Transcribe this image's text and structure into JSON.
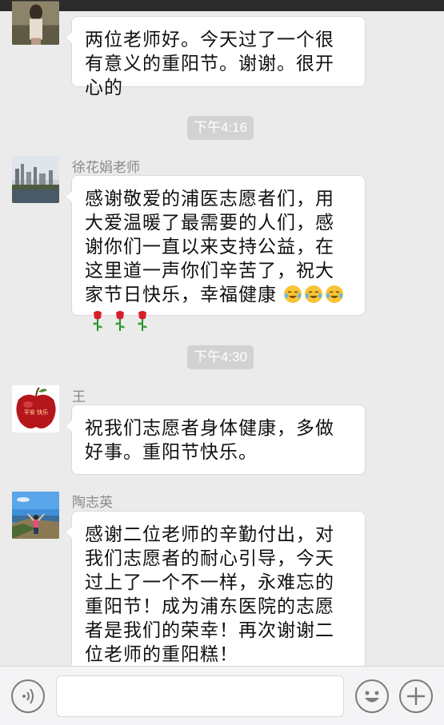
{
  "messages": [
    {
      "sender": "",
      "text": "两位老师好。今天过了一个很有意义的重阳节。谢谢。很开心的",
      "avatar_icon": "person-photo-avatar"
    },
    {
      "sender": "徐花娟老师",
      "text": "感谢敬爱的浦医志愿者们，用大爱温暖了最需要的人们，感谢你们一直以来支持公益，在这里道一声你们辛苦了，祝大家节日快乐，幸福健康",
      "emoji": [
        "laughing-tears-emoji",
        "laughing-tears-emoji",
        "laughing-tears-emoji",
        "rose-emoji",
        "rose-emoji",
        "rose-emoji"
      ],
      "avatar_icon": "city-skyline-avatar"
    },
    {
      "sender": "王",
      "text": "祝我们志愿者身体健康，多做好事。重阳节快乐。",
      "avatar_icon": "red-apple-avatar",
      "avatar_text": "平安 快乐"
    },
    {
      "sender": "陶志英",
      "text": "感谢二位老师的辛勤付出，对我们志愿者的耐心引导，今天过上了一个不一样，永难忘的重阳节！成为浦东医院的志愿者是我们的荣幸！再次谢谢二位老师的重阳糕！",
      "avatar_icon": "seaside-person-avatar"
    }
  ],
  "timestamps": [
    "下午4:16",
    "下午4:30"
  ],
  "input_bar": {
    "voice_icon": "voice-icon",
    "emoji_icon": "emoji-face-icon",
    "plus_icon": "plus-icon",
    "input_value": ""
  },
  "colors": {
    "background": "#ebebeb",
    "bubble": "#ffffff",
    "timestamp_bg": "#d2d2d2",
    "name": "#8a8a8a"
  }
}
